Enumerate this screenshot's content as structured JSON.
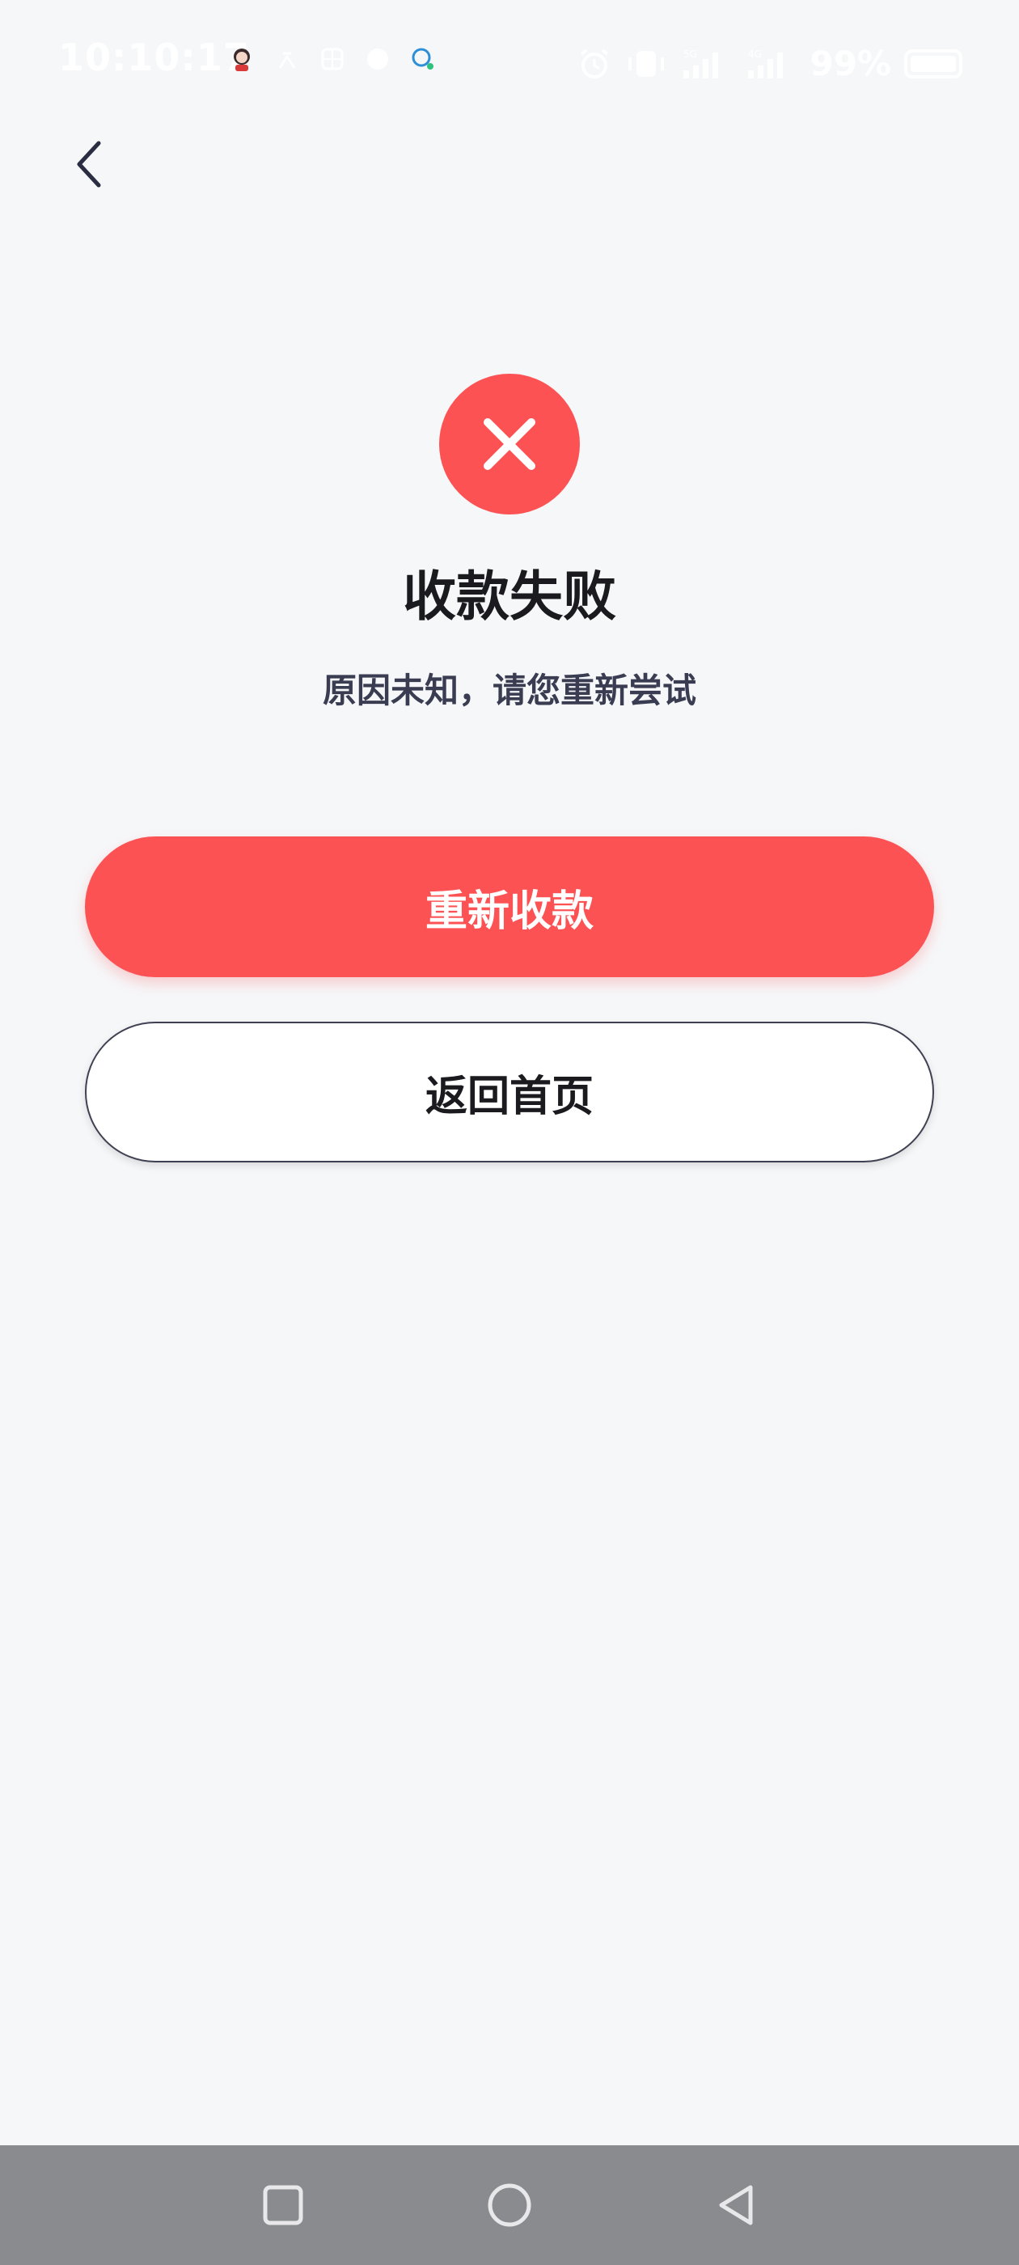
{
  "status_bar": {
    "time": "10:10:17",
    "battery_percent": "99%",
    "battery_level": 99,
    "signal_labels": [
      "5G",
      "4G"
    ]
  },
  "header": {
    "back_icon": "chevron-left-icon"
  },
  "result": {
    "icon": "close-icon",
    "status_color": "#fc5254",
    "title": "收款失败",
    "message": "原因未知，请您重新尝试"
  },
  "actions": {
    "retry_label": "重新收款",
    "home_label": "返回首页"
  },
  "nav_bar": {
    "recent_icon": "square-icon",
    "home_icon": "circle-icon",
    "back_icon": "triangle-back-icon"
  },
  "colors": {
    "accent": "#fc5254",
    "background": "#f6f7f9",
    "text_primary": "#1b1b1f",
    "text_secondary": "#3a3d52",
    "nav_bar": "#8a8b8f"
  }
}
